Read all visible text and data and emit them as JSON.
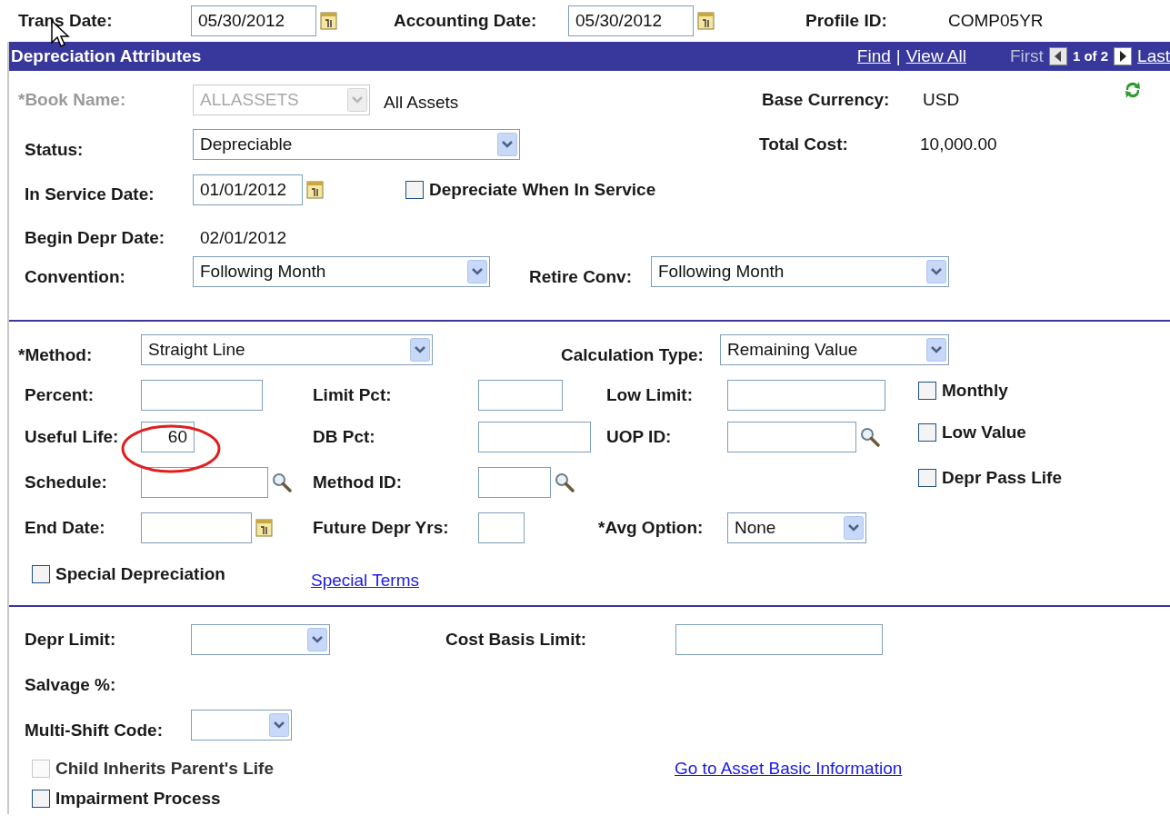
{
  "top": {
    "trans_date": {
      "label": "Trans Date:",
      "value": "05/30/2012"
    },
    "accounting_date": {
      "label": "Accounting Date:",
      "value": "05/30/2012"
    },
    "profile_id": {
      "label": "Profile ID:",
      "value": "COMP05YR"
    }
  },
  "panel": {
    "title": "Depreciation Attributes",
    "find": "Find",
    "separator": "|",
    "view_all": "View All",
    "first": "First",
    "page": "1 of 2",
    "last": "Last"
  },
  "book_name": {
    "label": "*Book Name:",
    "value": "ALLASSETS",
    "description": "All Assets",
    "disabled": true
  },
  "base_currency": {
    "label": "Base Currency:",
    "value": "USD"
  },
  "status": {
    "label": "Status:",
    "value": "Depreciable"
  },
  "total_cost": {
    "label": "Total Cost:",
    "value": "10,000.00"
  },
  "in_service_date": {
    "label": "In Service Date:",
    "value": "01/01/2012"
  },
  "depreciate_when_in_service": {
    "label": "Depreciate When In Service",
    "checked": false,
    "disabled": false
  },
  "begin_depr_date": {
    "label": "Begin Depr Date:",
    "value": "02/01/2012"
  },
  "convention": {
    "label": "Convention:",
    "value": "Following Month"
  },
  "retire_conv": {
    "label": "Retire Conv:",
    "value": "Following Month"
  },
  "method": {
    "label": "*Method:",
    "value": "Straight Line"
  },
  "calculation_type": {
    "label": "Calculation Type:",
    "value": "Remaining Value"
  },
  "percent": {
    "label": "Percent:"
  },
  "limit_pct": {
    "label": "Limit Pct:"
  },
  "low_limit": {
    "label": "Low Limit:"
  },
  "monthly": {
    "label": "Monthly",
    "checked": false,
    "disabled": false
  },
  "useful_life": {
    "label": "Useful Life:",
    "value": "60"
  },
  "db_pct": {
    "label": "DB Pct:"
  },
  "uop_id": {
    "label": "UOP ID:"
  },
  "low_value": {
    "label": "Low Value",
    "checked": false,
    "disabled": false
  },
  "schedule": {
    "label": "Schedule:"
  },
  "method_id": {
    "label": "Method ID:"
  },
  "depr_pass_life": {
    "label": "Depr Pass Life",
    "checked": false,
    "disabled": false
  },
  "end_date": {
    "label": "End Date:"
  },
  "future_depr_yrs": {
    "label": "Future Depr Yrs:"
  },
  "avg_option": {
    "label": "*Avg Option:",
    "value": "None"
  },
  "special_depreciation": {
    "label": "Special Depreciation",
    "checked": false,
    "disabled": false
  },
  "special_terms": "Special Terms",
  "depr_limit": {
    "label": "Depr Limit:"
  },
  "cost_basis_limit": {
    "label": "Cost Basis Limit:"
  },
  "salvage_pct": {
    "label": "Salvage %:"
  },
  "multi_shift_code": {
    "label": "Multi-Shift Code:"
  },
  "child_inherits": {
    "label": "Child Inherits Parent's Life",
    "checked": false,
    "disabled": true
  },
  "go_to_asset": "Go to Asset Basic Information",
  "impairment_process": {
    "label": "Impairment Process",
    "checked": false,
    "disabled": false
  }
}
